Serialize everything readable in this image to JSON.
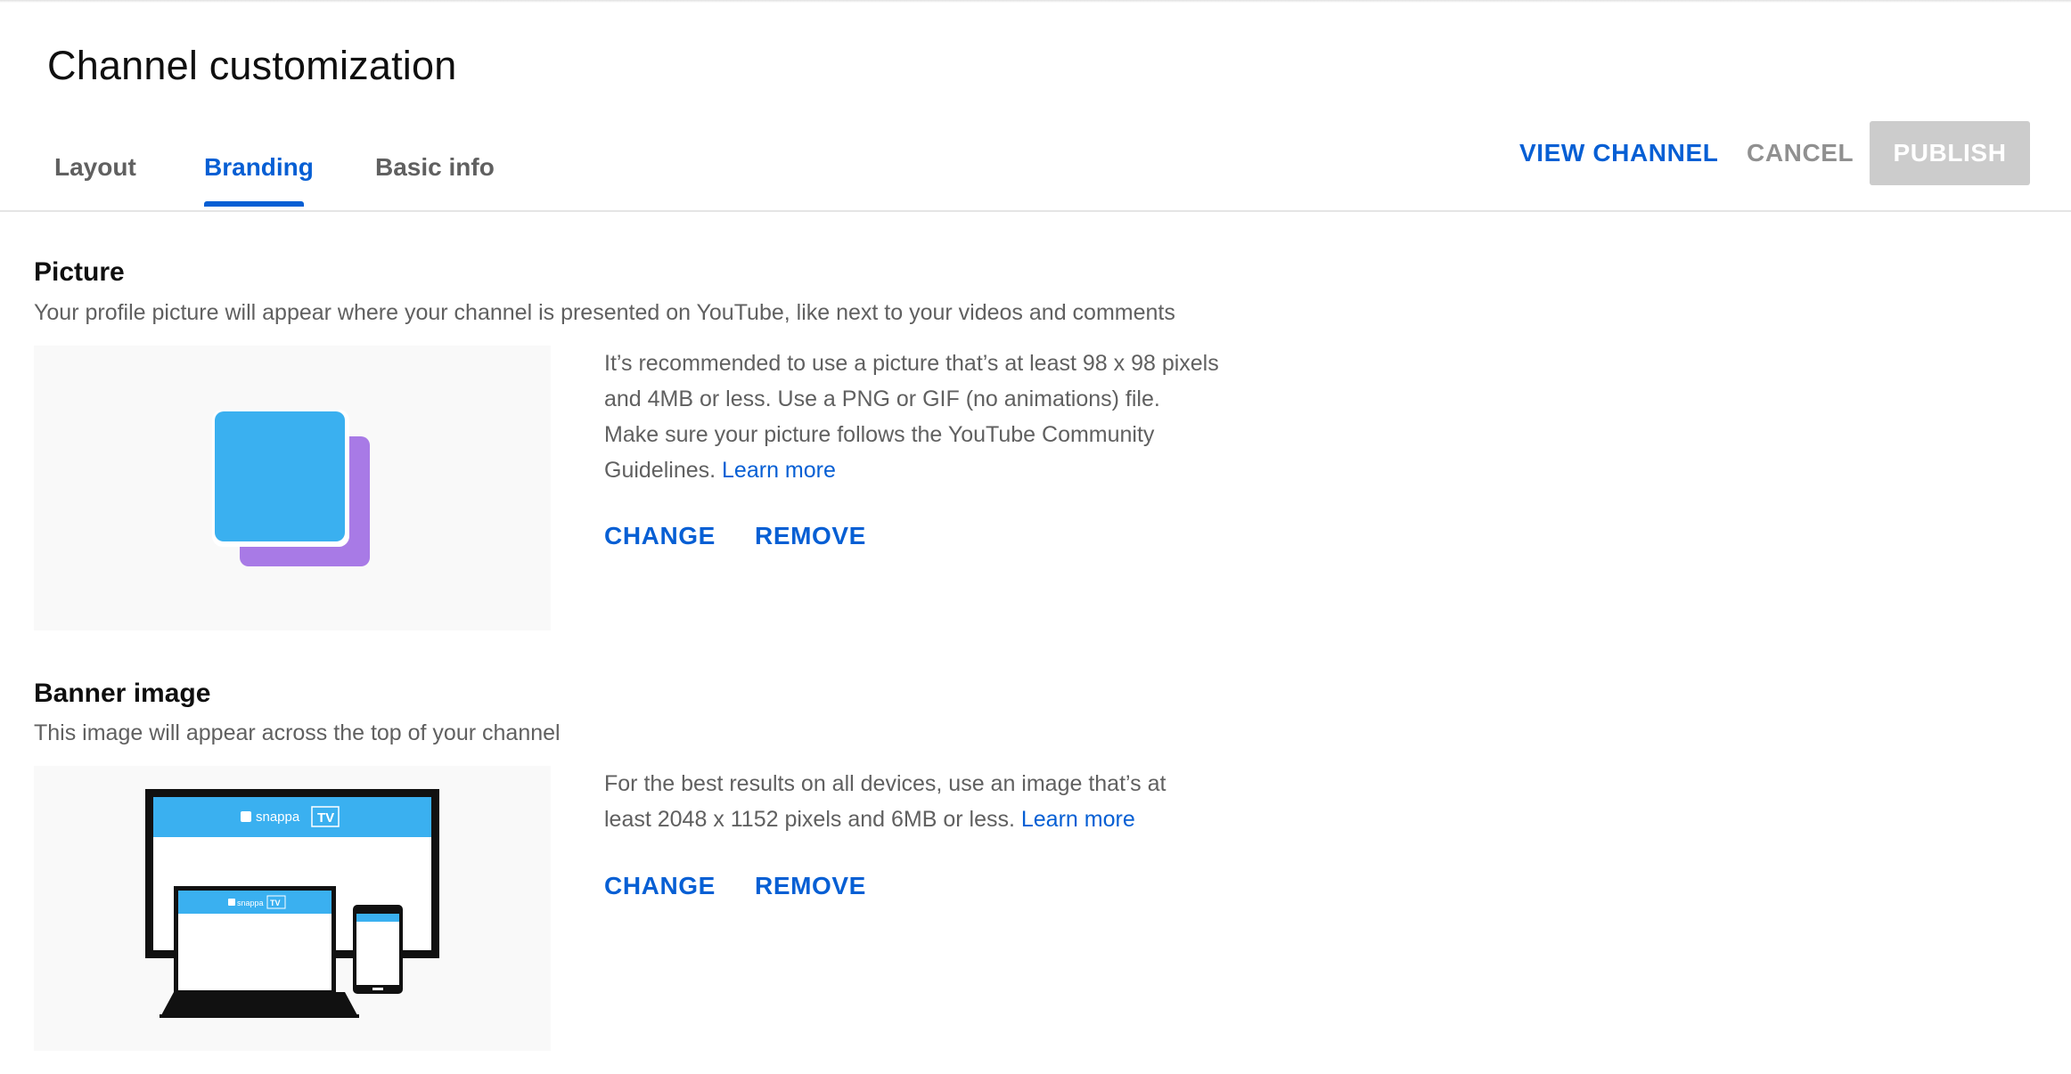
{
  "header": {
    "title": "Channel customization"
  },
  "tabs": [
    {
      "label": "Layout",
      "active": false
    },
    {
      "label": "Branding",
      "active": true
    },
    {
      "label": "Basic info",
      "active": false
    }
  ],
  "actions": {
    "view_channel": "VIEW CHANNEL",
    "cancel": "CANCEL",
    "publish": "PUBLISH"
  },
  "picture": {
    "title": "Picture",
    "description": "Your profile picture will appear where your channel is presented on YouTube, like next to your videos and comments",
    "info": "It’s recommended to use a picture that’s at least 98 x 98 pixels and 4MB or less. Use a PNG or GIF (no animations) file. Make sure your picture follows the YouTube Community Guidelines.",
    "learn_more": "Learn more",
    "change": "CHANGE",
    "remove": "REMOVE"
  },
  "banner": {
    "title": "Banner image",
    "description": "This image will appear across the top of your channel",
    "info": "For the best results on all devices, use an image that’s at least 2048 x 1152 pixels and 6MB or less.",
    "learn_more": "Learn more",
    "change": "CHANGE",
    "remove": "REMOVE",
    "preview_brand": "snappa",
    "preview_badge": "TV"
  },
  "colors": {
    "accent": "#065fd4",
    "muted": "#606060",
    "disabled_bg": "#cccccc",
    "preview_blue": "#3ab0f0",
    "preview_purple": "#a87ae6"
  }
}
